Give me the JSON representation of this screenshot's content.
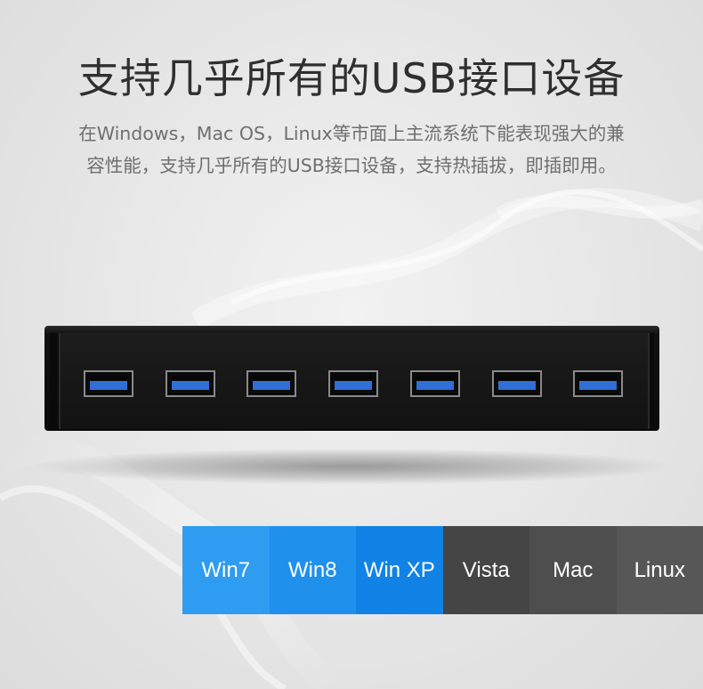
{
  "headline": "支持几乎所有的USB接口设备",
  "description": {
    "line1": "在Windows，Mac OS，Linux等市面上主流系统下能表现强大的兼",
    "line2": "容性能，支持几乎所有的USB接口设备，支持热插拔，即插即用。"
  },
  "product": {
    "port_count": 7,
    "port_color": "#2f6fd6",
    "body_color": "#111111"
  },
  "os_list": [
    {
      "label": "Win7",
      "color": "#2e9cf0"
    },
    {
      "label": "Win8",
      "color": "#1f90ec"
    },
    {
      "label": "Win XP",
      "color": "#1183e6"
    },
    {
      "label": "Vista",
      "color": "#454545"
    },
    {
      "label": "Mac",
      "color": "#4e4e4e"
    },
    {
      "label": "Linux",
      "color": "#575757"
    }
  ]
}
